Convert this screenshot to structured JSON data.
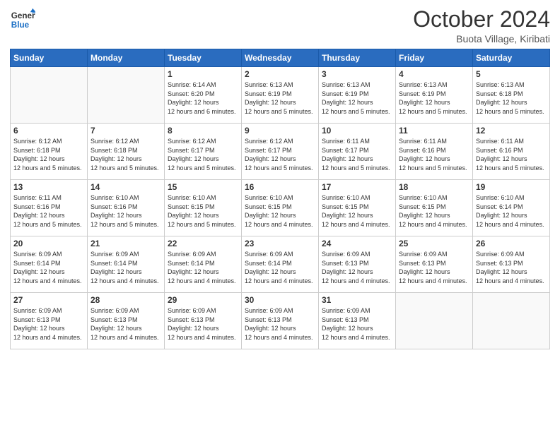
{
  "header": {
    "logo_line1": "General",
    "logo_line2": "Blue",
    "month": "October 2024",
    "location": "Buota Village, Kiribati"
  },
  "weekdays": [
    "Sunday",
    "Monday",
    "Tuesday",
    "Wednesday",
    "Thursday",
    "Friday",
    "Saturday"
  ],
  "weeks": [
    [
      {
        "day": "",
        "empty": true
      },
      {
        "day": "",
        "empty": true
      },
      {
        "day": "1",
        "sunrise": "6:14 AM",
        "sunset": "6:20 PM",
        "daylight": "12 hours and 6 minutes."
      },
      {
        "day": "2",
        "sunrise": "6:13 AM",
        "sunset": "6:19 PM",
        "daylight": "12 hours and 5 minutes."
      },
      {
        "day": "3",
        "sunrise": "6:13 AM",
        "sunset": "6:19 PM",
        "daylight": "12 hours and 5 minutes."
      },
      {
        "day": "4",
        "sunrise": "6:13 AM",
        "sunset": "6:19 PM",
        "daylight": "12 hours and 5 minutes."
      },
      {
        "day": "5",
        "sunrise": "6:13 AM",
        "sunset": "6:18 PM",
        "daylight": "12 hours and 5 minutes."
      }
    ],
    [
      {
        "day": "6",
        "sunrise": "6:12 AM",
        "sunset": "6:18 PM",
        "daylight": "12 hours and 5 minutes."
      },
      {
        "day": "7",
        "sunrise": "6:12 AM",
        "sunset": "6:18 PM",
        "daylight": "12 hours and 5 minutes."
      },
      {
        "day": "8",
        "sunrise": "6:12 AM",
        "sunset": "6:17 PM",
        "daylight": "12 hours and 5 minutes."
      },
      {
        "day": "9",
        "sunrise": "6:12 AM",
        "sunset": "6:17 PM",
        "daylight": "12 hours and 5 minutes."
      },
      {
        "day": "10",
        "sunrise": "6:11 AM",
        "sunset": "6:17 PM",
        "daylight": "12 hours and 5 minutes."
      },
      {
        "day": "11",
        "sunrise": "6:11 AM",
        "sunset": "6:16 PM",
        "daylight": "12 hours and 5 minutes."
      },
      {
        "day": "12",
        "sunrise": "6:11 AM",
        "sunset": "6:16 PM",
        "daylight": "12 hours and 5 minutes."
      }
    ],
    [
      {
        "day": "13",
        "sunrise": "6:11 AM",
        "sunset": "6:16 PM",
        "daylight": "12 hours and 5 minutes."
      },
      {
        "day": "14",
        "sunrise": "6:10 AM",
        "sunset": "6:16 PM",
        "daylight": "12 hours and 5 minutes."
      },
      {
        "day": "15",
        "sunrise": "6:10 AM",
        "sunset": "6:15 PM",
        "daylight": "12 hours and 5 minutes."
      },
      {
        "day": "16",
        "sunrise": "6:10 AM",
        "sunset": "6:15 PM",
        "daylight": "12 hours and 4 minutes."
      },
      {
        "day": "17",
        "sunrise": "6:10 AM",
        "sunset": "6:15 PM",
        "daylight": "12 hours and 4 minutes."
      },
      {
        "day": "18",
        "sunrise": "6:10 AM",
        "sunset": "6:15 PM",
        "daylight": "12 hours and 4 minutes."
      },
      {
        "day": "19",
        "sunrise": "6:10 AM",
        "sunset": "6:14 PM",
        "daylight": "12 hours and 4 minutes."
      }
    ],
    [
      {
        "day": "20",
        "sunrise": "6:09 AM",
        "sunset": "6:14 PM",
        "daylight": "12 hours and 4 minutes."
      },
      {
        "day": "21",
        "sunrise": "6:09 AM",
        "sunset": "6:14 PM",
        "daylight": "12 hours and 4 minutes."
      },
      {
        "day": "22",
        "sunrise": "6:09 AM",
        "sunset": "6:14 PM",
        "daylight": "12 hours and 4 minutes."
      },
      {
        "day": "23",
        "sunrise": "6:09 AM",
        "sunset": "6:14 PM",
        "daylight": "12 hours and 4 minutes."
      },
      {
        "day": "24",
        "sunrise": "6:09 AM",
        "sunset": "6:13 PM",
        "daylight": "12 hours and 4 minutes."
      },
      {
        "day": "25",
        "sunrise": "6:09 AM",
        "sunset": "6:13 PM",
        "daylight": "12 hours and 4 minutes."
      },
      {
        "day": "26",
        "sunrise": "6:09 AM",
        "sunset": "6:13 PM",
        "daylight": "12 hours and 4 minutes."
      }
    ],
    [
      {
        "day": "27",
        "sunrise": "6:09 AM",
        "sunset": "6:13 PM",
        "daylight": "12 hours and 4 minutes."
      },
      {
        "day": "28",
        "sunrise": "6:09 AM",
        "sunset": "6:13 PM",
        "daylight": "12 hours and 4 minutes."
      },
      {
        "day": "29",
        "sunrise": "6:09 AM",
        "sunset": "6:13 PM",
        "daylight": "12 hours and 4 minutes."
      },
      {
        "day": "30",
        "sunrise": "6:09 AM",
        "sunset": "6:13 PM",
        "daylight": "12 hours and 4 minutes."
      },
      {
        "day": "31",
        "sunrise": "6:09 AM",
        "sunset": "6:13 PM",
        "daylight": "12 hours and 4 minutes."
      },
      {
        "day": "",
        "empty": true
      },
      {
        "day": "",
        "empty": true
      }
    ]
  ]
}
